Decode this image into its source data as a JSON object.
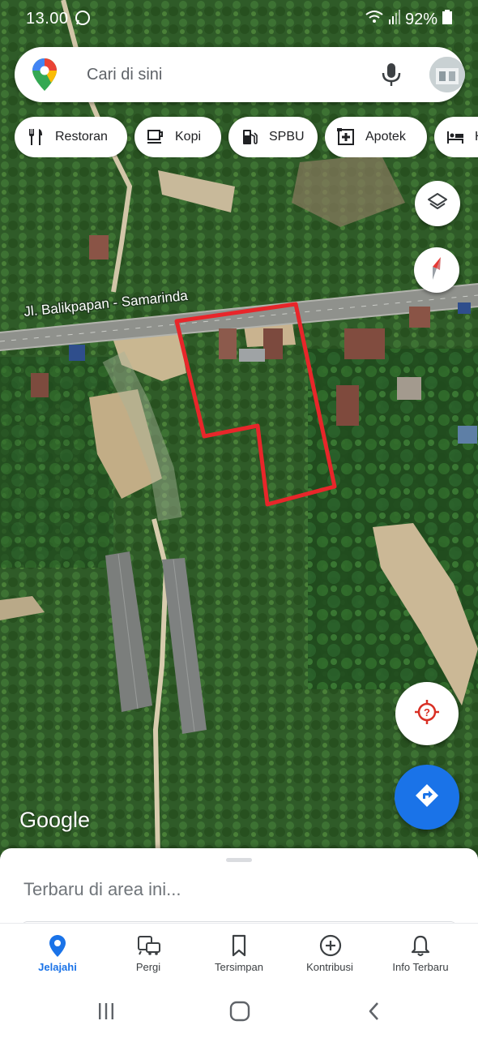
{
  "status_bar": {
    "time": "13.00",
    "battery": "92%"
  },
  "search": {
    "placeholder": "Cari di sini"
  },
  "chips": [
    {
      "label": "Restoran",
      "icon": "restaurant-icon"
    },
    {
      "label": "Kopi",
      "icon": "coffee-icon"
    },
    {
      "label": "SPBU",
      "icon": "gas-station-icon"
    },
    {
      "label": "Apotek",
      "icon": "pharmacy-icon"
    },
    {
      "label": "H",
      "icon": "hotel-icon"
    }
  ],
  "map": {
    "road_label": "Jl. Balikpapan - Samarinda",
    "attribution": "Google"
  },
  "sheet": {
    "title": "Terbaru di area ini..."
  },
  "bottom_nav": [
    {
      "label": "Jelajahi",
      "icon": "explore-pin-icon",
      "active": true
    },
    {
      "label": "Pergi",
      "icon": "commute-icon",
      "active": false
    },
    {
      "label": "Tersimpan",
      "icon": "bookmark-icon",
      "active": false
    },
    {
      "label": "Kontribusi",
      "icon": "add-circle-icon",
      "active": false
    },
    {
      "label": "Info Terbaru",
      "icon": "bell-icon",
      "active": false
    }
  ],
  "colors": {
    "accent": "#1a73e8",
    "highlight": "#e8262a",
    "location_button": "#d93025"
  }
}
